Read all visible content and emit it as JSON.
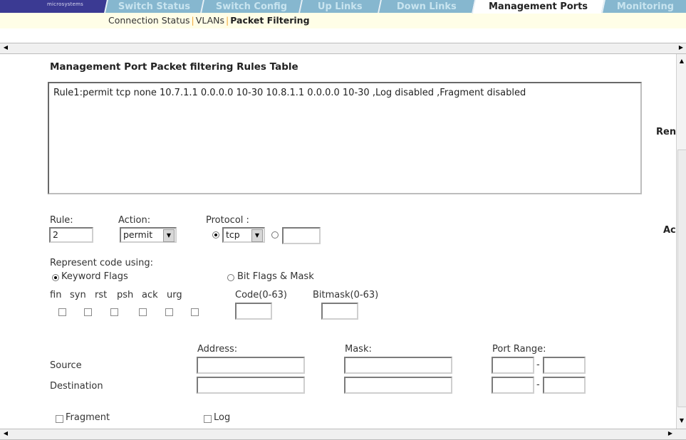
{
  "brand": {
    "logo_text": "microsystems"
  },
  "tabs": [
    {
      "label": "Switch Status",
      "active": false
    },
    {
      "label": "Switch Config",
      "active": false
    },
    {
      "label": "Up Links",
      "active": false
    },
    {
      "label": "Down Links",
      "active": false
    },
    {
      "label": "Management Ports",
      "active": true
    },
    {
      "label": "Monitoring",
      "active": false
    }
  ],
  "subnav": {
    "items": [
      "Connection Status",
      "VLANs",
      "Packet Filtering"
    ],
    "separator": "|",
    "current": "Packet Filtering"
  },
  "rules_table": {
    "title": "Management Port Packet filtering Rules Table",
    "rows": [
      "Rule1:permit tcp none 10.7.1.1 0.0.0.0 10-30 10.8.1.1 0.0.0.0 10-30 ,Log disabled ,Fragment disabled"
    ]
  },
  "side_buttons": {
    "remove_partial": "Ren",
    "add_partial": "Ac"
  },
  "form": {
    "rule_label": "Rule:",
    "rule_value": "2",
    "action_label": "Action:",
    "action_value": "permit",
    "protocol_label": "Protocol :",
    "protocol_value": "tcp",
    "protocol_custom_value": "",
    "represent_label": "Represent code using:",
    "keyword_flags_label": "Keyword Flags",
    "bit_flags_label": "Bit Flags & Mask",
    "flags": [
      "fin",
      "syn",
      "rst",
      "psh",
      "ack",
      "urg"
    ],
    "code_label": "Code(0-63)",
    "bitmask_label": "Bitmask(0-63)",
    "address_label": "Address:",
    "mask_label": "Mask:",
    "port_range_label": "Port Range:",
    "source_label": "Source",
    "destination_label": "Destination",
    "range_dash": "-",
    "fragment_label": "Fragment",
    "log_label": "Log"
  },
  "colors": {
    "tab_bg": "#86b7cf",
    "tab_text": "#c8e4ef",
    "header_strip": "#3b3a93",
    "subnav_bg": "#fffee7",
    "separator": "#f2a93b"
  }
}
